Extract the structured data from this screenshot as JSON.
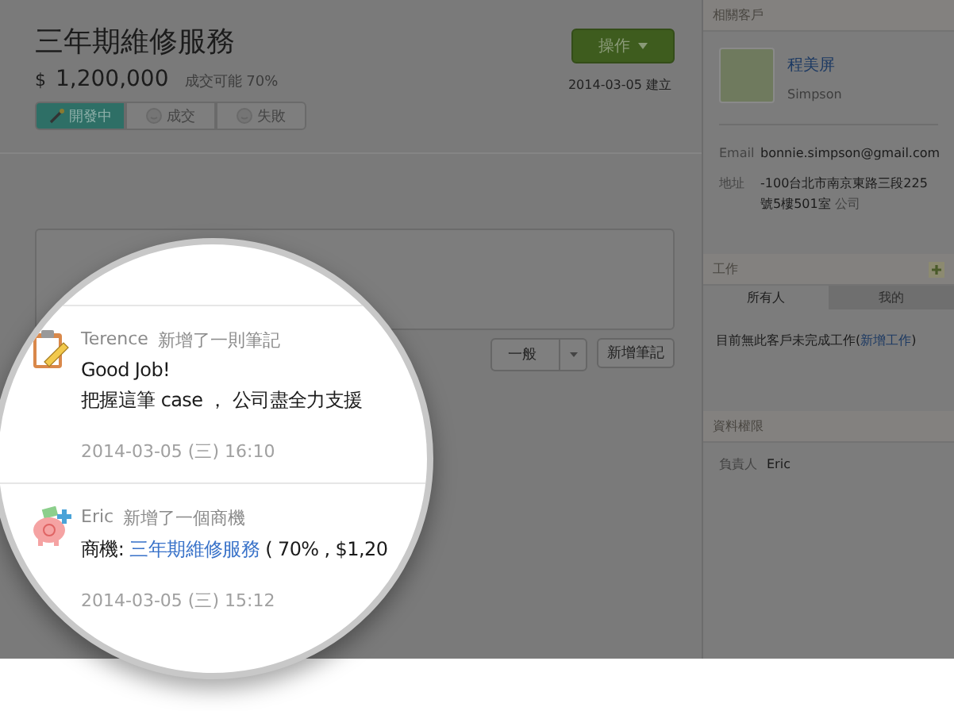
{
  "deal": {
    "title": "三年期維修服務",
    "currency": "$",
    "amount": "1,200,000",
    "probability": "成交可能 70%",
    "action_button": "操作",
    "created": "2014-03-05 建立"
  },
  "stages": [
    {
      "label": "開發中",
      "selected": true
    },
    {
      "label": "成交",
      "selected": false
    },
    {
      "label": "失敗",
      "selected": false
    }
  ],
  "note_form": {
    "type_select": "一般",
    "submit": "新增筆記"
  },
  "sidebar": {
    "contact": {
      "header": "相關客戶",
      "name": "程美屏",
      "english_name": "Simpson",
      "fields": [
        {
          "label": "Email",
          "value": "bonnie.simpson@gmail.com"
        },
        {
          "label": "地址",
          "value": "-100台北市南京東路三段225號5樓501室",
          "tag": "公司"
        }
      ]
    },
    "tasks": {
      "header": "工作",
      "tabs": [
        {
          "label": "所有人",
          "selected": true
        },
        {
          "label": "我的",
          "selected": false
        }
      ],
      "message": "目前無此客戶未完成工作(",
      "link": "新增工作",
      "message_end": ")"
    },
    "permissions": {
      "header": "資料權限",
      "fields": [
        {
          "label": "負責人",
          "value": "Eric"
        }
      ]
    }
  },
  "feed": [
    {
      "kind": "note",
      "author": "Terence",
      "action": "新增了一則筆記",
      "lines": [
        "Good Job!",
        "把握這筆 case ， 公司盡全力支援"
      ],
      "time": "2014-03-05 (三) 16:10"
    },
    {
      "kind": "deal",
      "author": "Eric",
      "action": "新增了一個商機",
      "prefix": "商機:",
      "link": "三年期維修服務",
      "suffix": "( 70% , $1,20",
      "time": "2014-03-05 (三) 15:12"
    }
  ]
}
